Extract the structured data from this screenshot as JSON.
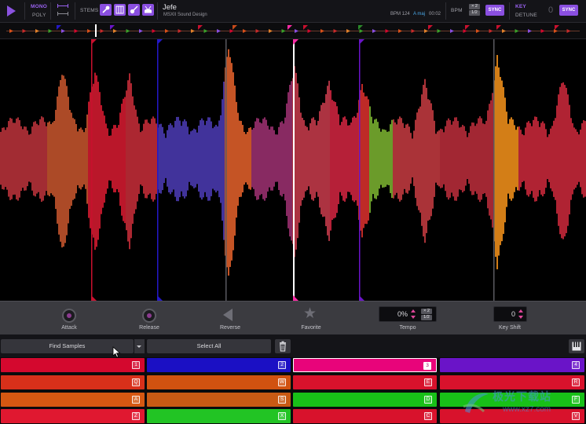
{
  "topbar": {
    "mono_label": "MONO",
    "poly_label": "POLY",
    "stems_label": "STEMS",
    "stem_buttons": [
      {
        "icon": "mic-icon",
        "glyph": "🎤"
      },
      {
        "icon": "piano-icon",
        "glyph": "▥"
      },
      {
        "icon": "guitar-icon",
        "glyph": "🎸"
      },
      {
        "icon": "drums-icon",
        "glyph": "🥁"
      }
    ],
    "song_title": "Jefe",
    "song_artist": "MSXII Sound Design",
    "bpm_info": "BPM 124",
    "key_info": "A maj",
    "time_info": "00:02",
    "bpm_label": "BPM",
    "bpm_double": "× 2",
    "bpm_half": "1/2",
    "sync_label": "SYNC",
    "key_label": "KEY",
    "detune_label": "DETUNE",
    "key_value": "0",
    "key_sync_label": "SYNC"
  },
  "controls": {
    "attack_label": "Attack",
    "release_label": "Release",
    "reverse_label": "Reverse",
    "favorite_label": "Favorite",
    "tempo_label": "Tempo",
    "tempo_value": "0%",
    "tempo_double": "× 2",
    "tempo_half": "1/2",
    "keyshift_label": "Key Shift",
    "keyshift_value": "0"
  },
  "toolbar": {
    "find_samples_label": "Find Samples",
    "select_all_label": "Select All"
  },
  "pads": [
    {
      "key": "1",
      "color": "#d4082e"
    },
    {
      "key": "2",
      "color": "#1b10c4"
    },
    {
      "key": "3",
      "color": "#e8047a",
      "selected": true
    },
    {
      "key": "4",
      "color": "#6a14c8"
    },
    {
      "key": "Q",
      "color": "#d8301a"
    },
    {
      "key": "W",
      "color": "#d15210"
    },
    {
      "key": "E",
      "color": "#d8122c"
    },
    {
      "key": "R",
      "color": "#d8122c"
    },
    {
      "key": "A",
      "color": "#d65812"
    },
    {
      "key": "S",
      "color": "#c95a14"
    },
    {
      "key": "D",
      "color": "#18c018"
    },
    {
      "key": "F",
      "color": "#18c018"
    },
    {
      "key": "Z",
      "color": "#e01830"
    },
    {
      "key": "X",
      "color": "#22c424"
    },
    {
      "key": "C",
      "color": "#d8122c"
    },
    {
      "key": "V",
      "color": "#d8122c"
    }
  ],
  "watermark": {
    "cn_text": "极光下载站",
    "url_text": "www.xz7.com"
  },
  "colors": {
    "accent": "#8a4fe0",
    "pink": "#e8047a",
    "playhead": "#ff2aa6"
  }
}
